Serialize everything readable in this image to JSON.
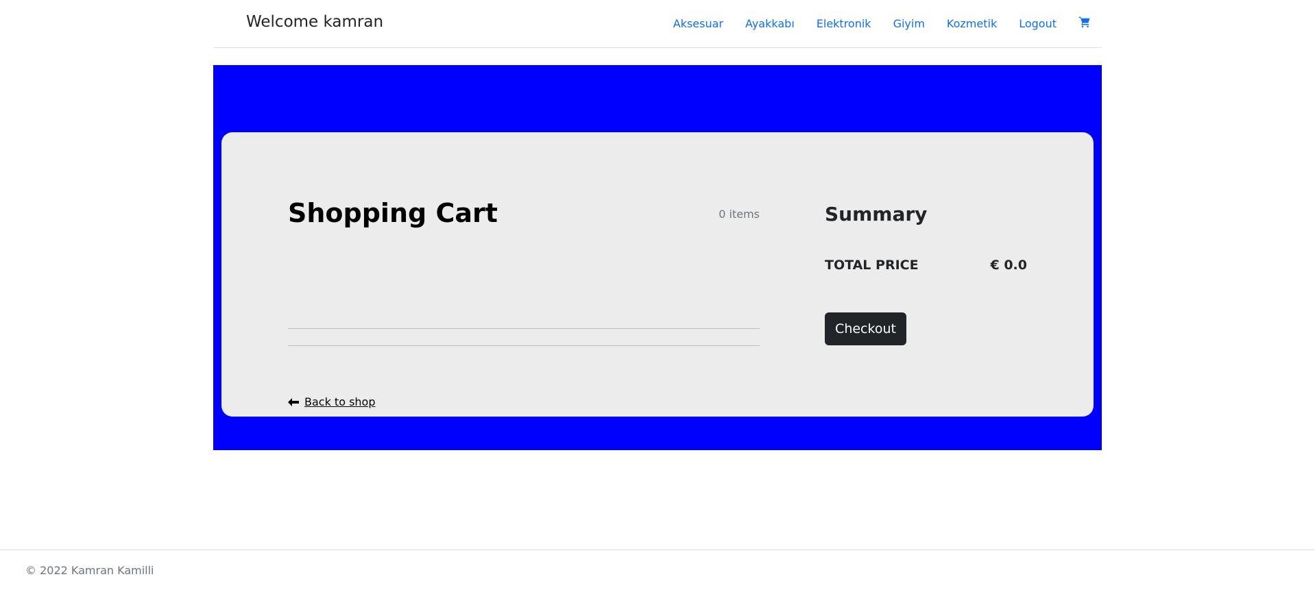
{
  "header": {
    "brand": "Welcome kamran",
    "nav_items": [
      {
        "label": "Aksesuar"
      },
      {
        "label": "Ayakkabı"
      },
      {
        "label": "Elektronik"
      },
      {
        "label": "Giyim"
      },
      {
        "label": "Kozmetik"
      },
      {
        "label": "Logout"
      }
    ],
    "cart_icon": "shopping-cart-icon"
  },
  "cart": {
    "title": "Shopping Cart",
    "items_count": "0 items",
    "back_link": "Back to shop",
    "back_icon": "arrow-left-icon"
  },
  "summary": {
    "title": "Summary",
    "total_label": "TOTAL PRICE",
    "total_value": "€ 0.0",
    "checkout_label": "Checkout"
  },
  "footer": {
    "copyright": "© 2022 Kamran Kamilli"
  },
  "colors": {
    "hero_background": "#0000ff",
    "card_background": "#ececec",
    "link": "#0d6efd",
    "button": "#212529"
  }
}
